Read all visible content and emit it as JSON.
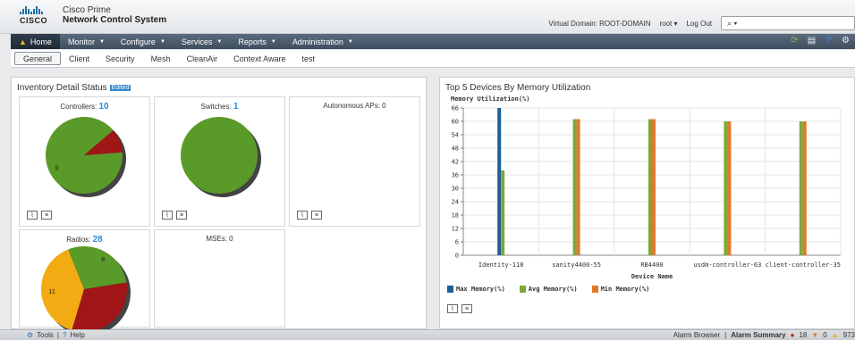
{
  "header": {
    "logo_text": "CISCO",
    "product_line1": "Cisco Prime",
    "product_line2": "Network Control System",
    "virtual_domain": "Virtual Domain: ROOT-DOMAIN",
    "user": "root",
    "logout": "Log Out",
    "search_placeholder": ""
  },
  "nav": {
    "items": [
      {
        "label": "Home"
      },
      {
        "label": "Monitor"
      },
      {
        "label": "Configure"
      },
      {
        "label": "Services"
      },
      {
        "label": "Reports"
      },
      {
        "label": "Administration"
      }
    ]
  },
  "subtabs": [
    "General",
    "Client",
    "Security",
    "Mesh",
    "CleanAir",
    "Context Aware",
    "test"
  ],
  "inventory": {
    "title": "Inventory Detail Status",
    "badge": "Edited",
    "cells": [
      {
        "label": "Controllers:",
        "count": "10",
        "slices": [
          {
            "value": 9,
            "color": "#5a9a28",
            "label": "9"
          },
          {
            "value": 1,
            "color": "#a01515",
            "label": ""
          }
        ]
      },
      {
        "label": "Switches:",
        "count": "1",
        "slices": [
          {
            "value": 1,
            "color": "#5a9a28",
            "label": ""
          }
        ]
      },
      {
        "label": "Autonomous APs: 0",
        "count": "",
        "slices": []
      },
      {
        "label": "Radios:",
        "count": "28",
        "slices": [
          {
            "value": 9,
            "color": "#a01515",
            "label": ""
          },
          {
            "value": 11,
            "color": "#f2ab12",
            "label": "11"
          },
          {
            "value": 8,
            "color": "#5a9a28",
            "label": "8"
          }
        ]
      },
      {
        "label": "MSEs: 0",
        "count": "",
        "slices": []
      }
    ]
  },
  "chart_data": {
    "type": "bar",
    "title": "Top 5 Devices By Memory Utilization",
    "ylabel": "Memory Utilization(%)",
    "xlabel": "Device Name",
    "ylim": [
      0,
      66
    ],
    "yticks": [
      0,
      6,
      12,
      18,
      24,
      30,
      36,
      42,
      48,
      54,
      60,
      66
    ],
    "categories": [
      "Identity-118",
      "sanity4400-55",
      "RB4400",
      "usdm-controller-63",
      "client-controller-35"
    ],
    "series": [
      {
        "name": "Max Memory(%)",
        "color": "#1f5f96",
        "values": [
          66,
          null,
          null,
          null,
          null
        ]
      },
      {
        "name": "Avg Memory(%)",
        "color": "#7ea83a",
        "values": [
          38,
          61,
          61,
          60,
          60
        ]
      },
      {
        "name": "Min Memory(%)",
        "color": "#e07a2a",
        "values": [
          null,
          61,
          61,
          60,
          60
        ]
      }
    ],
    "legend_position": "bottom-left",
    "grid": true
  },
  "footer": {
    "tools": "Tools",
    "help": "Help",
    "alarm_browser": "Alarm Browser",
    "alarm_summary": "Alarm Summary",
    "critical": "18",
    "major": "0",
    "minor": "973"
  }
}
